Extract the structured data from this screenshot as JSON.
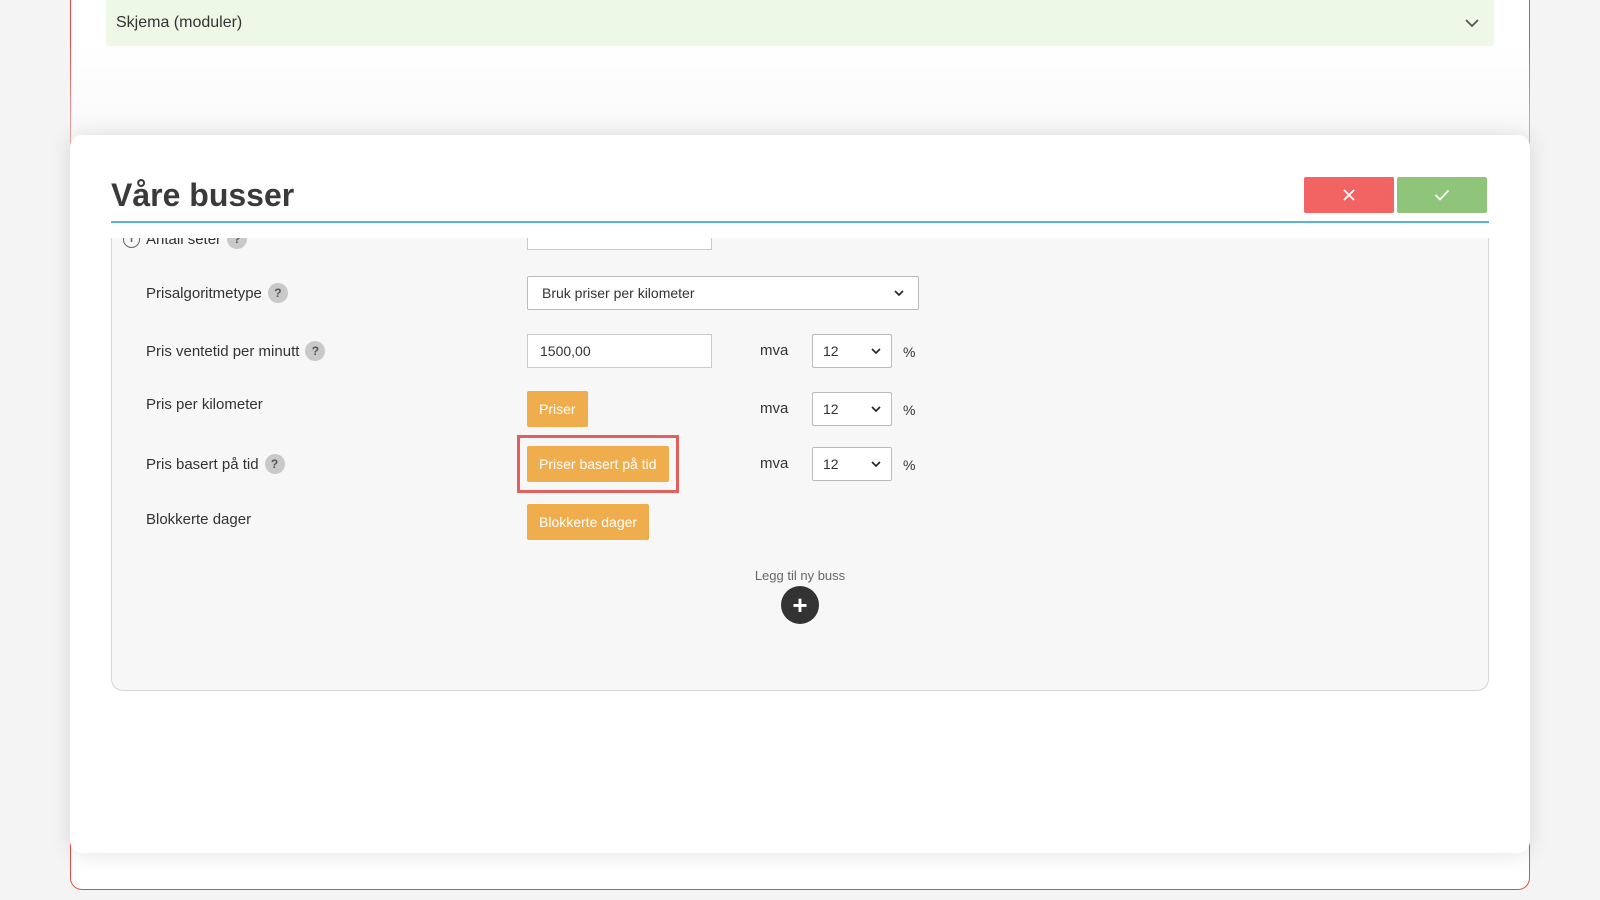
{
  "background": {
    "accordion_label": "Skjema (moduler)"
  },
  "modal": {
    "title": "Våre busser",
    "close_icon": "close-icon",
    "confirm_icon": "check-icon"
  },
  "form": {
    "seats": {
      "label": "Antall seter"
    },
    "price_algorithm": {
      "label": "Prisalgoritmetype",
      "help": "?",
      "value": "Bruk priser per kilometer"
    },
    "wait_price": {
      "label": "Pris ventetid per minutt",
      "help": "?",
      "value": "1500,00",
      "mva_label": "mva",
      "mva_value": "12",
      "unit": "%"
    },
    "km_price": {
      "label": "Pris per kilometer",
      "button": "Priser",
      "mva_label": "mva",
      "mva_value": "12",
      "unit": "%"
    },
    "time_price": {
      "label": "Pris basert på tid",
      "help": "?",
      "button": "Priser basert på tid",
      "mva_label": "mva",
      "mva_value": "12",
      "unit": "%"
    },
    "blocked_days": {
      "label": "Blokkerte dager",
      "button": "Blokkerte dager"
    }
  },
  "add_bus": {
    "label": "Legg til ny buss",
    "icon": "+"
  },
  "colors": {
    "accent_orange": "#f0ad4e",
    "cancel_red": "#f26363",
    "confirm_green": "#8fc57a",
    "title_underline": "#5ab4d6",
    "highlight": "#e06060"
  }
}
